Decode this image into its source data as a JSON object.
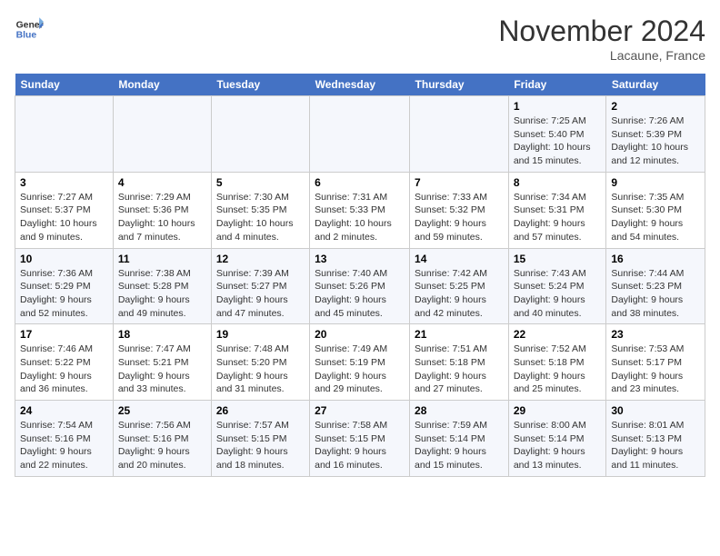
{
  "header": {
    "logo_line1": "General",
    "logo_line2": "Blue",
    "month_title": "November 2024",
    "subtitle": "Lacaune, France"
  },
  "weekdays": [
    "Sunday",
    "Monday",
    "Tuesday",
    "Wednesday",
    "Thursday",
    "Friday",
    "Saturday"
  ],
  "weeks": [
    [
      {
        "day": "",
        "info": ""
      },
      {
        "day": "",
        "info": ""
      },
      {
        "day": "",
        "info": ""
      },
      {
        "day": "",
        "info": ""
      },
      {
        "day": "",
        "info": ""
      },
      {
        "day": "1",
        "info": "Sunrise: 7:25 AM\nSunset: 5:40 PM\nDaylight: 10 hours and 15 minutes."
      },
      {
        "day": "2",
        "info": "Sunrise: 7:26 AM\nSunset: 5:39 PM\nDaylight: 10 hours and 12 minutes."
      }
    ],
    [
      {
        "day": "3",
        "info": "Sunrise: 7:27 AM\nSunset: 5:37 PM\nDaylight: 10 hours and 9 minutes."
      },
      {
        "day": "4",
        "info": "Sunrise: 7:29 AM\nSunset: 5:36 PM\nDaylight: 10 hours and 7 minutes."
      },
      {
        "day": "5",
        "info": "Sunrise: 7:30 AM\nSunset: 5:35 PM\nDaylight: 10 hours and 4 minutes."
      },
      {
        "day": "6",
        "info": "Sunrise: 7:31 AM\nSunset: 5:33 PM\nDaylight: 10 hours and 2 minutes."
      },
      {
        "day": "7",
        "info": "Sunrise: 7:33 AM\nSunset: 5:32 PM\nDaylight: 9 hours and 59 minutes."
      },
      {
        "day": "8",
        "info": "Sunrise: 7:34 AM\nSunset: 5:31 PM\nDaylight: 9 hours and 57 minutes."
      },
      {
        "day": "9",
        "info": "Sunrise: 7:35 AM\nSunset: 5:30 PM\nDaylight: 9 hours and 54 minutes."
      }
    ],
    [
      {
        "day": "10",
        "info": "Sunrise: 7:36 AM\nSunset: 5:29 PM\nDaylight: 9 hours and 52 minutes."
      },
      {
        "day": "11",
        "info": "Sunrise: 7:38 AM\nSunset: 5:28 PM\nDaylight: 9 hours and 49 minutes."
      },
      {
        "day": "12",
        "info": "Sunrise: 7:39 AM\nSunset: 5:27 PM\nDaylight: 9 hours and 47 minutes."
      },
      {
        "day": "13",
        "info": "Sunrise: 7:40 AM\nSunset: 5:26 PM\nDaylight: 9 hours and 45 minutes."
      },
      {
        "day": "14",
        "info": "Sunrise: 7:42 AM\nSunset: 5:25 PM\nDaylight: 9 hours and 42 minutes."
      },
      {
        "day": "15",
        "info": "Sunrise: 7:43 AM\nSunset: 5:24 PM\nDaylight: 9 hours and 40 minutes."
      },
      {
        "day": "16",
        "info": "Sunrise: 7:44 AM\nSunset: 5:23 PM\nDaylight: 9 hours and 38 minutes."
      }
    ],
    [
      {
        "day": "17",
        "info": "Sunrise: 7:46 AM\nSunset: 5:22 PM\nDaylight: 9 hours and 36 minutes."
      },
      {
        "day": "18",
        "info": "Sunrise: 7:47 AM\nSunset: 5:21 PM\nDaylight: 9 hours and 33 minutes."
      },
      {
        "day": "19",
        "info": "Sunrise: 7:48 AM\nSunset: 5:20 PM\nDaylight: 9 hours and 31 minutes."
      },
      {
        "day": "20",
        "info": "Sunrise: 7:49 AM\nSunset: 5:19 PM\nDaylight: 9 hours and 29 minutes."
      },
      {
        "day": "21",
        "info": "Sunrise: 7:51 AM\nSunset: 5:18 PM\nDaylight: 9 hours and 27 minutes."
      },
      {
        "day": "22",
        "info": "Sunrise: 7:52 AM\nSunset: 5:18 PM\nDaylight: 9 hours and 25 minutes."
      },
      {
        "day": "23",
        "info": "Sunrise: 7:53 AM\nSunset: 5:17 PM\nDaylight: 9 hours and 23 minutes."
      }
    ],
    [
      {
        "day": "24",
        "info": "Sunrise: 7:54 AM\nSunset: 5:16 PM\nDaylight: 9 hours and 22 minutes."
      },
      {
        "day": "25",
        "info": "Sunrise: 7:56 AM\nSunset: 5:16 PM\nDaylight: 9 hours and 20 minutes."
      },
      {
        "day": "26",
        "info": "Sunrise: 7:57 AM\nSunset: 5:15 PM\nDaylight: 9 hours and 18 minutes."
      },
      {
        "day": "27",
        "info": "Sunrise: 7:58 AM\nSunset: 5:15 PM\nDaylight: 9 hours and 16 minutes."
      },
      {
        "day": "28",
        "info": "Sunrise: 7:59 AM\nSunset: 5:14 PM\nDaylight: 9 hours and 15 minutes."
      },
      {
        "day": "29",
        "info": "Sunrise: 8:00 AM\nSunset: 5:14 PM\nDaylight: 9 hours and 13 minutes."
      },
      {
        "day": "30",
        "info": "Sunrise: 8:01 AM\nSunset: 5:13 PM\nDaylight: 9 hours and 11 minutes."
      }
    ]
  ]
}
